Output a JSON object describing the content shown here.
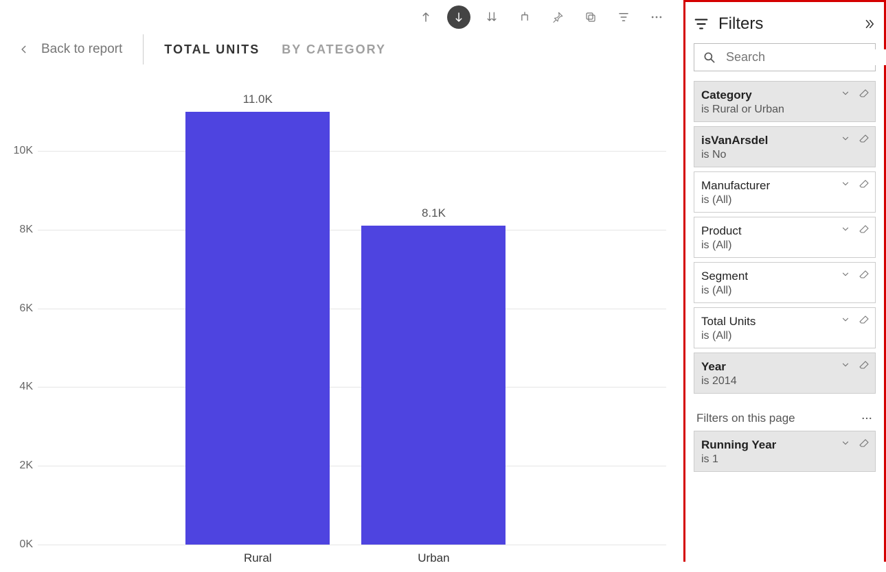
{
  "header": {
    "back_label": "Back to report",
    "tabs": [
      {
        "label": "Total Units",
        "active": true
      },
      {
        "label": "By Category",
        "active": false
      }
    ]
  },
  "toolbar_icons": [
    "drill-up-icon",
    "drill-down-active-icon",
    "drill-all-icon",
    "expand-icon",
    "pin-icon",
    "copy-icon",
    "filter-icon",
    "more-icon"
  ],
  "chart_data": {
    "type": "bar",
    "categories": [
      "Rural",
      "Urban"
    ],
    "values": [
      11000,
      8100
    ],
    "value_labels": [
      "11.0K",
      "8.1K"
    ],
    "ylim": [
      0,
      11500
    ],
    "y_ticks": [
      0,
      2000,
      4000,
      6000,
      8000,
      10000
    ],
    "y_tick_labels": [
      "0K",
      "2K",
      "4K",
      "6K",
      "8K",
      "10K"
    ],
    "title": "",
    "xlabel": "",
    "ylabel": ""
  },
  "filters_pane": {
    "title": "Filters",
    "search_placeholder": "Search",
    "cards": [
      {
        "name": "Category",
        "status": "is Rural or Urban",
        "applied": true
      },
      {
        "name": "isVanArsdel",
        "status": "is No",
        "applied": true
      },
      {
        "name": "Manufacturer",
        "status": "is (All)",
        "applied": false
      },
      {
        "name": "Product",
        "status": "is (All)",
        "applied": false
      },
      {
        "name": "Segment",
        "status": "is (All)",
        "applied": false
      },
      {
        "name": "Total Units",
        "status": "is (All)",
        "applied": false
      },
      {
        "name": "Year",
        "status": "is 2014",
        "applied": true
      }
    ],
    "page_filters_label": "Filters on this page",
    "page_cards": [
      {
        "name": "Running Year",
        "status": "is 1",
        "applied": true
      }
    ]
  }
}
